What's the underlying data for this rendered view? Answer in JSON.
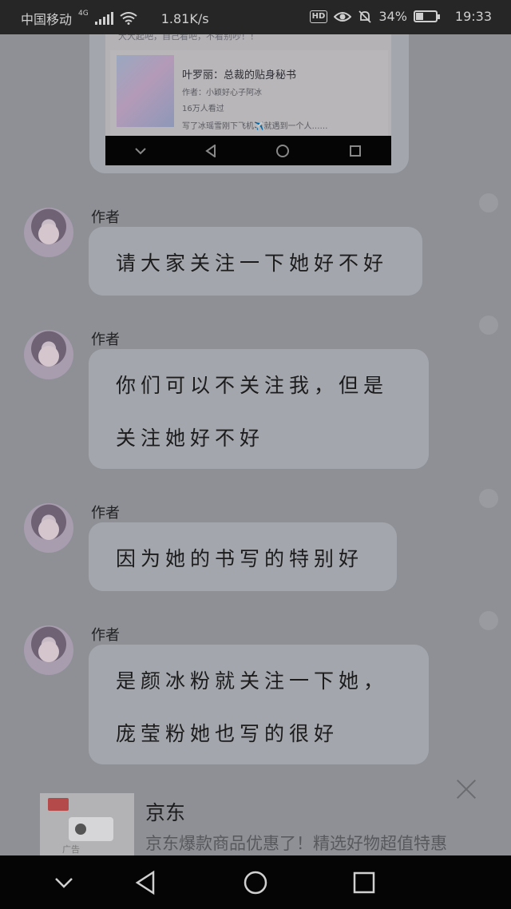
{
  "status_bar": {
    "carrier": "中国移动",
    "network_type": "4G",
    "speed": "1.81K/s",
    "hd_badge": "HD",
    "battery_percent": "34%",
    "battery_level": 0.34,
    "time": "19:33"
  },
  "shared_screenshot": {
    "top_line": "大大起吧，自己看吧，不看别吵！！",
    "book_title": "叶罗丽：总裁的贴身秘书",
    "book_author": "作者：小颖好心子阿冰",
    "book_reads": "16万人看过",
    "book_desc": "写了冰瑶雪刚下飞机✈️就遇到一个人……"
  },
  "messages": [
    {
      "author": "作者",
      "lines": [
        "请大家关注一下她好不好"
      ]
    },
    {
      "author": "作者",
      "lines": [
        "你们可以不关注我，但是",
        "关注她好不好"
      ]
    },
    {
      "author": "作者",
      "lines": [
        "因为她的书写的特别好"
      ]
    },
    {
      "author": "作者",
      "lines": [
        "是颜冰粉就关注一下她，",
        "庞莹粉她也写的很好"
      ]
    }
  ],
  "ad": {
    "title": "京东",
    "description": "京东爆款商品优惠了！精选好物超值特惠",
    "tag": "广告"
  },
  "colors": {
    "background": "#8e9096",
    "bubble": "#a3a6ad",
    "system_bar": "#050505"
  }
}
